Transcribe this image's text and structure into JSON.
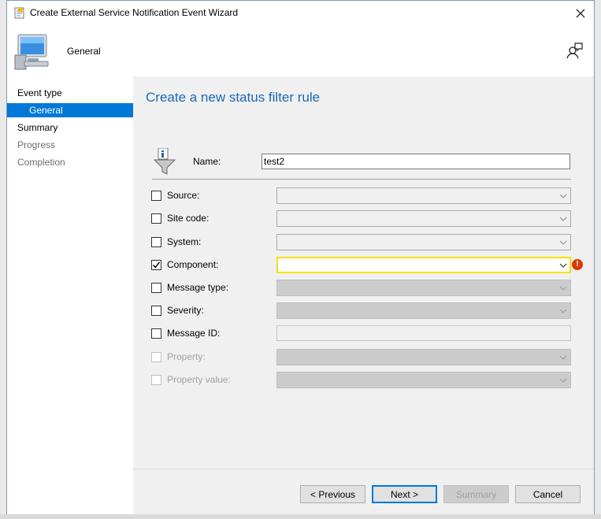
{
  "window": {
    "title": "Create External Service Notification Event Wizard",
    "header_title": "General"
  },
  "nav": {
    "items": [
      {
        "label": "Event type",
        "state": "normal"
      },
      {
        "label": "General",
        "state": "selected"
      },
      {
        "label": "Summary",
        "state": "normal"
      },
      {
        "label": "Progress",
        "state": "disabled"
      },
      {
        "label": "Completion",
        "state": "disabled"
      }
    ]
  },
  "main": {
    "heading": "Create a new status filter rule",
    "name_label": "Name:",
    "name_value": "test2",
    "filters": [
      {
        "label": "Source:",
        "checked": false,
        "enabled": true,
        "control": "combo",
        "value": ""
      },
      {
        "label": "Site code:",
        "checked": false,
        "enabled": true,
        "control": "combo",
        "value": ""
      },
      {
        "label": "System:",
        "checked": false,
        "enabled": true,
        "control": "combo",
        "value": ""
      },
      {
        "label": "Component:",
        "checked": true,
        "enabled": true,
        "control": "combo",
        "value": "",
        "error": true
      },
      {
        "label": "Message type:",
        "checked": false,
        "enabled": true,
        "control": "combo",
        "value": ""
      },
      {
        "label": "Severity:",
        "checked": false,
        "enabled": true,
        "control": "combo",
        "value": ""
      },
      {
        "label": "Message ID:",
        "checked": false,
        "enabled": true,
        "control": "text",
        "value": ""
      },
      {
        "label": "Property:",
        "checked": false,
        "enabled": false,
        "control": "combo",
        "value": ""
      },
      {
        "label": "Property value:",
        "checked": false,
        "enabled": false,
        "control": "combo",
        "value": ""
      }
    ],
    "error_glyph": "!"
  },
  "buttons": {
    "previous": "< Previous",
    "next": "Next >",
    "summary": "Summary",
    "cancel": "Cancel"
  },
  "colors": {
    "accent": "#0078d7",
    "heading": "#1a69b6",
    "error": "#d83b01",
    "highlight_border": "#f5e000"
  }
}
